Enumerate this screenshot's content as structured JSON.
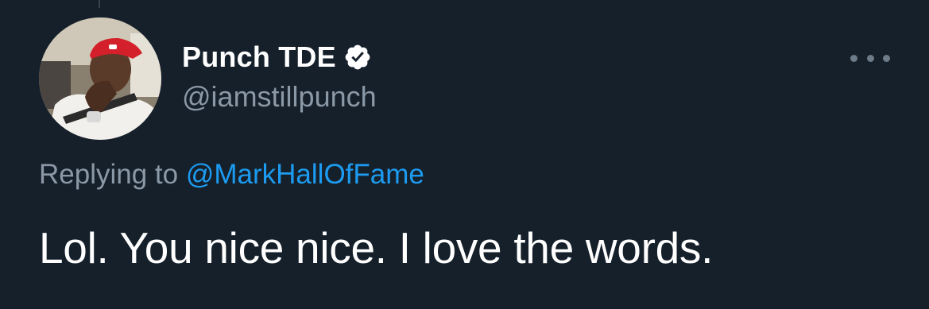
{
  "tweet": {
    "author": {
      "display_name": "Punch TDE",
      "handle": "@iamstillpunch",
      "verified": true
    },
    "reply_to": {
      "prefix": "Replying to",
      "mention": "@MarkHallOfFame"
    },
    "text": "Lol. You nice nice. I love the words.",
    "icons": {
      "more": "more-horizontal-icon",
      "verified": "verified-badge-icon"
    }
  },
  "colors": {
    "background": "#15202b",
    "primary_text": "#ffffff",
    "secondary_text": "#8b98a5",
    "accent": "#1d9bf0"
  }
}
